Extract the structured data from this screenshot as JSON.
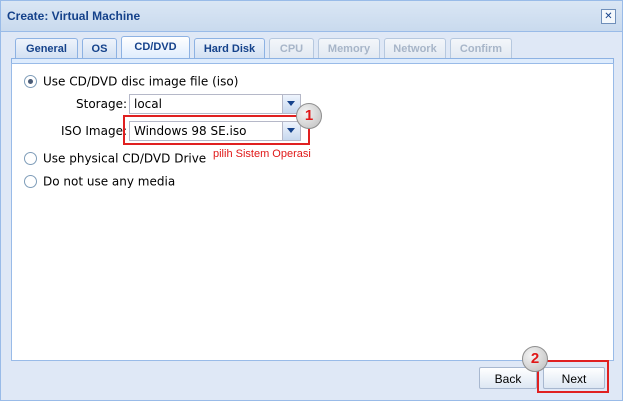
{
  "window": {
    "title": "Create: Virtual Machine",
    "close_glyph": "✕"
  },
  "tabs": [
    {
      "label": "General",
      "state": "normal"
    },
    {
      "label": "OS",
      "state": "normal"
    },
    {
      "label": "CD/DVD",
      "state": "active"
    },
    {
      "label": "Hard Disk",
      "state": "normal"
    },
    {
      "label": "CPU",
      "state": "disabled"
    },
    {
      "label": "Memory",
      "state": "disabled"
    },
    {
      "label": "Network",
      "state": "disabled"
    },
    {
      "label": "Confirm",
      "state": "disabled"
    }
  ],
  "media": {
    "option_iso": "Use CD/DVD disc image file (iso)",
    "option_physical": "Use physical CD/DVD Drive",
    "option_none": "Do not use any media",
    "storage_label": "Storage:",
    "storage_value": "local",
    "iso_label": "ISO Image:",
    "iso_value": "Windows 98 SE.iso"
  },
  "annotations": {
    "step1": "1",
    "step2": "2",
    "hint": "pilih Sistem Operasi",
    "color": "#e01818"
  },
  "footer": {
    "back_label": "Back",
    "next_label": "Next"
  }
}
